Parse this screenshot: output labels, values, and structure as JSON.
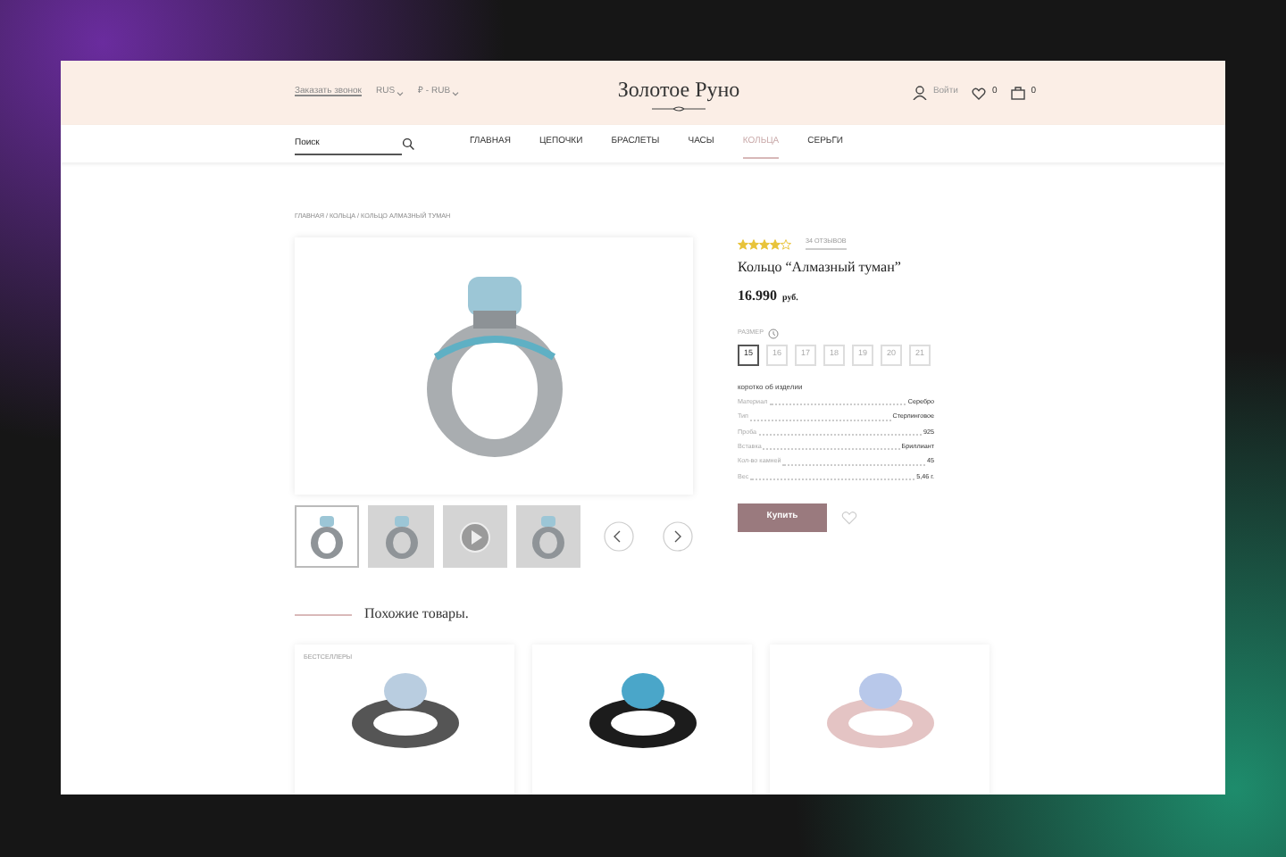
{
  "header": {
    "callback_link": "Заказать звонок",
    "language": "RUS",
    "currency": "₽ - RUB",
    "logo": "Золотое Руно",
    "login": "Войти",
    "favorites_count": "0",
    "cart_count": "0"
  },
  "search": {
    "placeholder": "Поиск"
  },
  "nav": [
    {
      "label": "ГЛАВНАЯ",
      "selected": false
    },
    {
      "label": "ЦЕПОЧКИ",
      "selected": false
    },
    {
      "label": "БРАСЛЕТЫ",
      "selected": false
    },
    {
      "label": "ЧАСЫ",
      "selected": false
    },
    {
      "label": "КОЛЬЦА",
      "selected": true
    },
    {
      "label": "СЕРЬГИ",
      "selected": false
    }
  ],
  "breadcrumbs": "ГЛАВНАЯ / КОЛЬЦА / КОЛЬЦО АЛМАЗНЫЙ ТУМАН",
  "gallery": {
    "thumbnails": [
      {
        "kind": "photo",
        "selected": true
      },
      {
        "kind": "photo",
        "selected": false
      },
      {
        "kind": "video",
        "selected": false
      },
      {
        "kind": "photo",
        "selected": false
      }
    ]
  },
  "product": {
    "stars": 4,
    "reviews": "34 ОТЗЫВОВ",
    "title": "Кольцо “Алмазный туман”",
    "price": "16.990",
    "currency": "руб.",
    "size_label": "РАЗМЕР",
    "sizes": [
      {
        "label": "15",
        "selected": true
      },
      {
        "label": "16",
        "selected": false
      },
      {
        "label": "17",
        "selected": false
      },
      {
        "label": "18",
        "selected": false
      },
      {
        "label": "19",
        "selected": false
      },
      {
        "label": "20",
        "selected": false
      },
      {
        "label": "21",
        "selected": false
      }
    ],
    "specs_title": "коротко об изделии",
    "specs": [
      {
        "name": "Материал",
        "value": "Серебро"
      },
      {
        "name": "Тип",
        "value": "Стерлинговое"
      },
      {
        "name": "Проба",
        "value": "925"
      },
      {
        "name": "Вставка",
        "value": "Бриллиант"
      },
      {
        "name": "Кол-во камней",
        "value": "45"
      },
      {
        "name": "Вес",
        "value": "5,46 г."
      }
    ],
    "buy_button": "Купить"
  },
  "similar": {
    "title": "Похожие товары.",
    "cards": [
      {
        "badge": "БЕСТСЕЛЛЕРЫ",
        "kind": "silver"
      },
      {
        "kind": "black"
      },
      {
        "kind": "rose"
      }
    ]
  }
}
